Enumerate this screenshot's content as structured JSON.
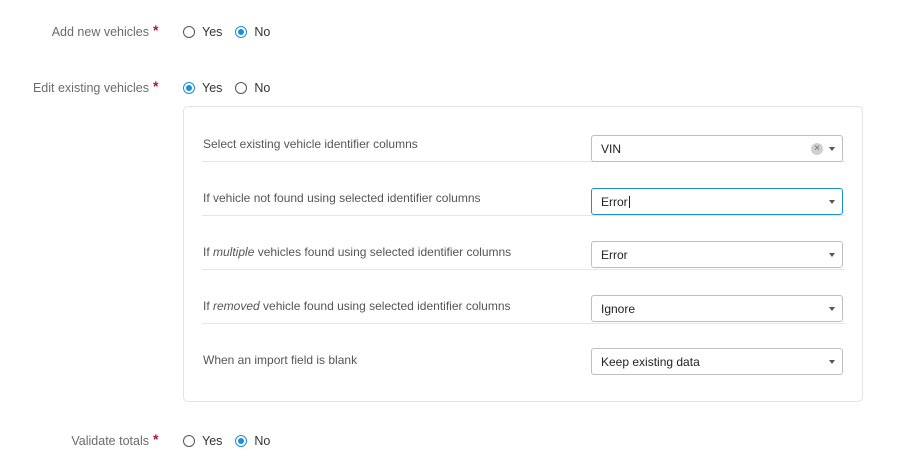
{
  "form": {
    "add_new_vehicles": {
      "label": "Add new vehicles",
      "required_mark": "*",
      "options": [
        "Yes",
        "No"
      ],
      "selected": "No"
    },
    "edit_existing_vehicles": {
      "label": "Edit existing vehicles",
      "required_mark": "*",
      "options": [
        "Yes",
        "No"
      ],
      "selected": "Yes"
    },
    "validate_totals": {
      "label": "Validate totals",
      "required_mark": "*",
      "options": [
        "Yes",
        "No"
      ],
      "selected": "No"
    }
  },
  "edit_panel": {
    "rows": [
      {
        "label": "Select existing vehicle identifier columns",
        "value": "VIN",
        "clearable": true
      },
      {
        "label": "If vehicle not found using selected identifier columns",
        "value": "Error",
        "focused": true
      },
      {
        "label_prefix": "If ",
        "label_emphasis": "multiple",
        "label_suffix": " vehicles found using selected identifier columns",
        "value": "Error"
      },
      {
        "label_prefix": "If ",
        "label_emphasis": "removed",
        "label_suffix": " vehicle found using selected identifier columns",
        "value": "Ignore"
      },
      {
        "label": "When an import field is blank",
        "value": "Keep existing data"
      }
    ]
  },
  "icons": {
    "clear": "close-circle-icon",
    "dropdown": "chevron-down-icon"
  },
  "colors": {
    "accent": "#1a8fd6",
    "required": "#a8183c",
    "label": "#6b6b6b",
    "border": "#bfbfbf"
  }
}
